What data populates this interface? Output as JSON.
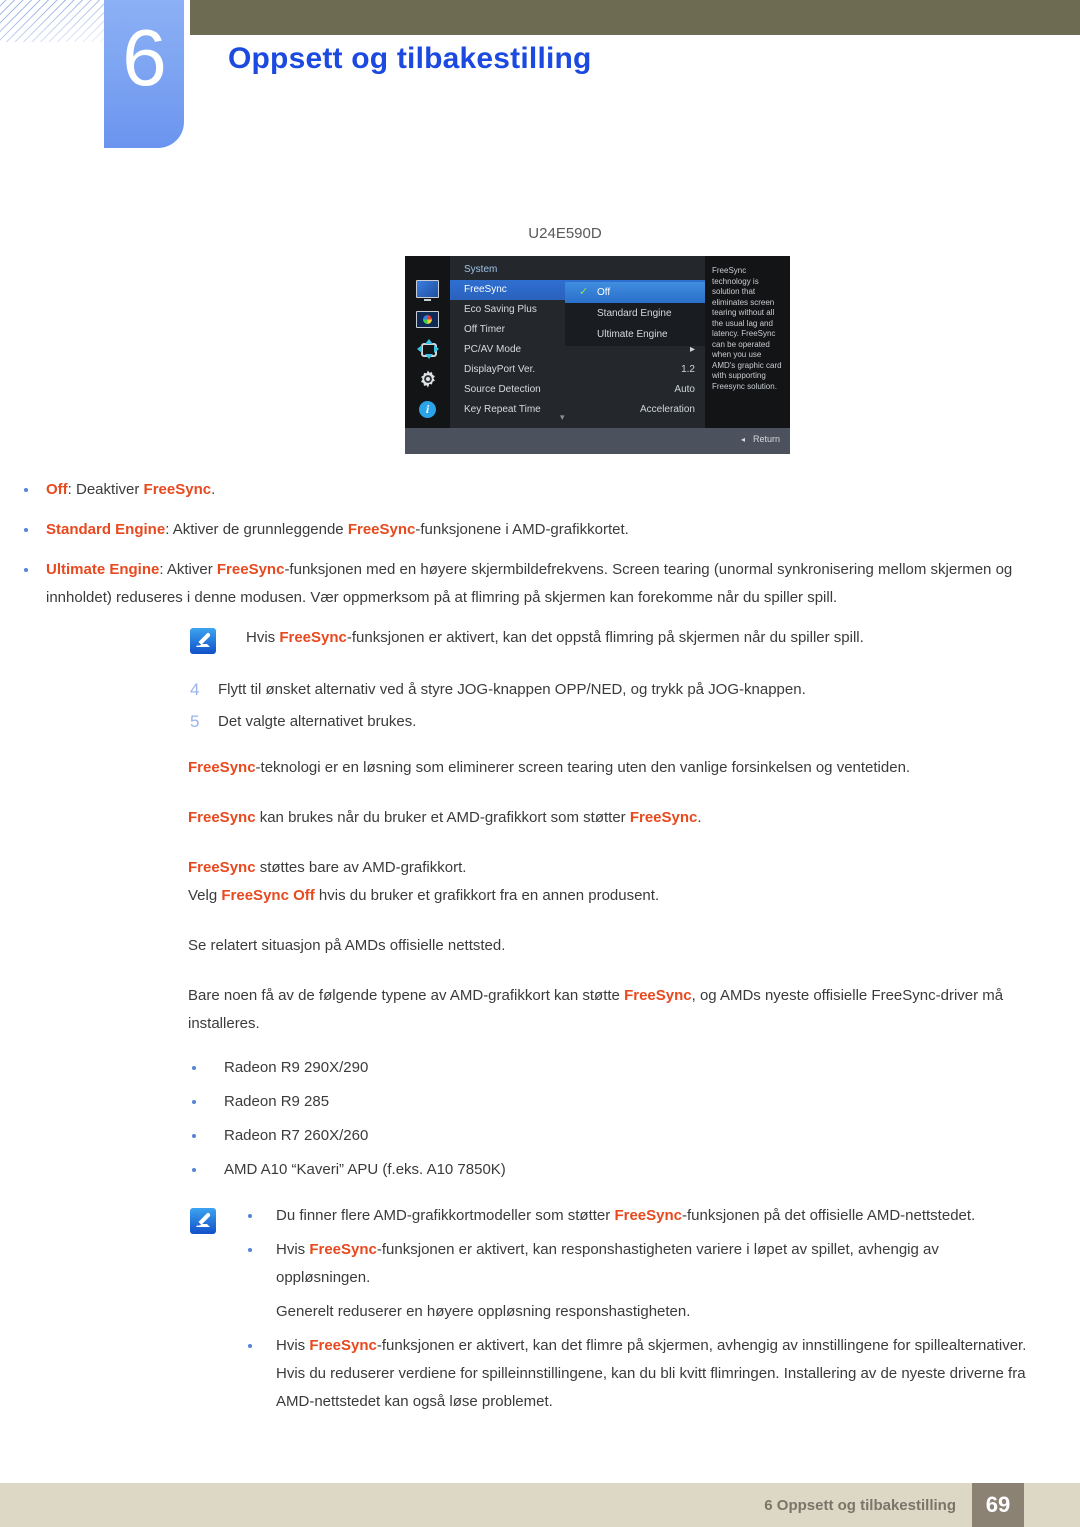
{
  "header": {
    "chapter_number": "6",
    "chapter_title": "Oppsett og tilbakestilling",
    "accent_blue": "#1c4ae0",
    "tab_blue": "#7ea5f2",
    "olive": "#6e6b53"
  },
  "osd": {
    "model_label": "U24E590D",
    "menu_heading": "System",
    "rows": [
      {
        "label": "FreeSync",
        "value": "",
        "selected": true
      },
      {
        "label": "Eco Saving Plus",
        "value": "",
        "selected": false
      },
      {
        "label": "Off Timer",
        "value": "",
        "selected": false
      },
      {
        "label": "PC/AV Mode",
        "value": "▸",
        "selected": false
      },
      {
        "label": "DisplayPort Ver.",
        "value": "1.2",
        "selected": false
      },
      {
        "label": "Source Detection",
        "value": "Auto",
        "selected": false
      },
      {
        "label": "Key Repeat Time",
        "value": "Acceleration",
        "selected": false
      }
    ],
    "scroll_caret": "▾",
    "submenu": [
      {
        "label": "Off",
        "selected": true,
        "check": "✓"
      },
      {
        "label": "Standard Engine",
        "selected": false,
        "check": ""
      },
      {
        "label": "Ultimate Engine",
        "selected": false,
        "check": ""
      }
    ],
    "help_text": "FreeSync technology is solution that eliminates screen tearing without all the usual lag and latency. FreeSync can be operated when you use AMD's graphic card with supporting Freesync solution.",
    "return_label": "Return",
    "return_caret": "◂",
    "icons": [
      "monitor-icon",
      "picture-color-icon",
      "four-arrows-icon",
      "gear-icon",
      "info-icon"
    ]
  },
  "bullets": [
    {
      "parts": [
        {
          "t": "Off",
          "s": "fs"
        },
        {
          "t": ": Deaktiver ",
          "s": ""
        },
        {
          "t": "FreeSync",
          "s": "fs"
        },
        {
          "t": ".",
          "s": ""
        }
      ]
    },
    {
      "parts": [
        {
          "t": "Standard Engine",
          "s": "fs"
        },
        {
          "t": ": Aktiver de grunnleggende ",
          "s": ""
        },
        {
          "t": "FreeSync",
          "s": "fs"
        },
        {
          "t": "-funksjonene i AMD-grafikkortet.",
          "s": ""
        }
      ]
    },
    {
      "parts": [
        {
          "t": "Ultimate Engine",
          "s": "fs"
        },
        {
          "t": ": Aktiver ",
          "s": ""
        },
        {
          "t": "FreeSync",
          "s": "fs"
        },
        {
          "t": "-funksjonen med en høyere skjermbildefrekvens. Screen tearing (unormal synkronisering mellom skjermen og innholdet) reduseres i denne modusen. Vær oppmerksom på at flimring på skjermen kan forekomme når du spiller spill.",
          "s": ""
        }
      ]
    }
  ],
  "note1": {
    "parts": [
      {
        "t": "Hvis ",
        "s": ""
      },
      {
        "t": "FreeSync",
        "s": "fs"
      },
      {
        "t": "-funksjonen er aktivert, kan det oppstå flimring på skjermen når du spiller spill.",
        "s": ""
      }
    ]
  },
  "steps": [
    {
      "num": "4",
      "text": "Flytt til ønsket alternativ ved å styre JOG-knappen OPP/NED, og trykk på JOG-knappen."
    },
    {
      "num": "5",
      "text": "Det valgte alternativet brukes."
    }
  ],
  "paragraphs": [
    {
      "parts": [
        {
          "t": "FreeSync",
          "s": "fs"
        },
        {
          "t": "-teknologi er en løsning som eliminerer screen tearing uten den vanlige forsinkelsen og ventetiden.",
          "s": ""
        }
      ]
    },
    {
      "parts": [
        {
          "t": "FreeSync",
          "s": "fs"
        },
        {
          "t": " kan brukes når du bruker et AMD-grafikkort som støtter ",
          "s": ""
        },
        {
          "t": "FreeSync",
          "s": "fs"
        },
        {
          "t": ".",
          "s": ""
        }
      ]
    },
    {
      "parts": [
        {
          "t": "FreeSync",
          "s": "fs"
        },
        {
          "t": " støttes bare av AMD-grafikkort.",
          "s": ""
        }
      ]
    },
    {
      "parts": [
        {
          "t": "Velg ",
          "s": ""
        },
        {
          "t": "FreeSync Off",
          "s": "fs"
        },
        {
          "t": " hvis du bruker et grafikkort fra en annen produsent.",
          "s": ""
        }
      ]
    },
    {
      "parts": [
        {
          "t": "Se relatert situasjon på AMDs offisielle nettsted.",
          "s": ""
        }
      ]
    },
    {
      "parts": [
        {
          "t": "Bare noen få av de følgende typene av AMD-grafikkort kan støtte ",
          "s": ""
        },
        {
          "t": "FreeSync",
          "s": "fs"
        },
        {
          "t": ", og AMDs nyeste offisielle FreeSync-driver må installeres.",
          "s": ""
        }
      ]
    }
  ],
  "gpu_list": [
    "Radeon R9 290X/290",
    "Radeon R9 285",
    "Radeon R7 260X/260",
    "AMD A10 “Kaveri” APU (f.eks. A10 7850K)"
  ],
  "note2": [
    {
      "type": "bullet",
      "parts": [
        {
          "t": "Du finner flere AMD-grafikkortmodeller som støtter ",
          "s": ""
        },
        {
          "t": "FreeSync",
          "s": "fs"
        },
        {
          "t": "-funksjonen på det offisielle AMD-nettstedet.",
          "s": ""
        }
      ]
    },
    {
      "type": "bullet",
      "parts": [
        {
          "t": "Hvis ",
          "s": ""
        },
        {
          "t": "FreeSync",
          "s": "fs"
        },
        {
          "t": "-funksjonen er aktivert, kan responshastigheten variere i løpet av spillet, avhengig av oppløsningen.",
          "s": ""
        }
      ]
    },
    {
      "type": "sub",
      "parts": [
        {
          "t": "Generelt reduserer en høyere oppløsning responshastigheten.",
          "s": ""
        }
      ]
    },
    {
      "type": "bullet",
      "parts": [
        {
          "t": "Hvis ",
          "s": ""
        },
        {
          "t": "FreeSync",
          "s": "fs"
        },
        {
          "t": "-funksjonen er aktivert, kan det flimre på skjermen, avhengig av innstillingene for spillealternativer. Hvis du reduserer verdiene for spilleinnstillingene, kan du bli kvitt flimringen. Installering av de nyeste driverne fra AMD-nettstedet kan også løse problemet.",
          "s": ""
        }
      ]
    }
  ],
  "footer": {
    "text": "6 Oppsett og tilbakestilling",
    "page": "69"
  }
}
